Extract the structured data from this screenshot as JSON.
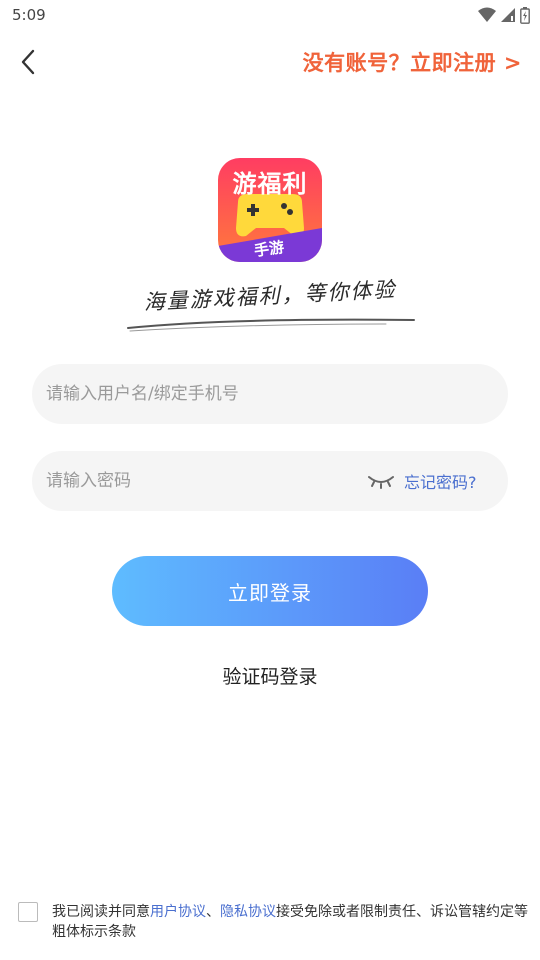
{
  "status_bar": {
    "time": "5:09"
  },
  "header": {
    "register_label": "没有账号？立即注册 >"
  },
  "logo": {
    "text": "游福利",
    "tag": "手游"
  },
  "slogan": "海量游戏福利，等你体验",
  "form": {
    "username_placeholder": "请输入用户名/绑定手机号",
    "username_value": "",
    "password_placeholder": "请输入密码",
    "password_value": "",
    "forgot_label": "忘记密码?",
    "login_label": "立即登录",
    "code_login_label": "验证码登录"
  },
  "agreement": {
    "prefix": "我已阅读并同意",
    "user_agreement": "用户协议",
    "separator": "、",
    "privacy_agreement": "隐私协议",
    "suffix": "接受免除或者限制责任、诉讼管辖约定等粗体标示条款"
  },
  "colors": {
    "accent_orange": "#f0633a",
    "link_blue": "#4a6fcf",
    "button_gradient_start": "#5ebcff",
    "button_gradient_end": "#5a7ef6",
    "input_bg": "#f5f5f5"
  },
  "icons": [
    "wifi-icon",
    "signal-icon",
    "battery-icon",
    "back-arrow-icon",
    "eye-closed-icon"
  ]
}
